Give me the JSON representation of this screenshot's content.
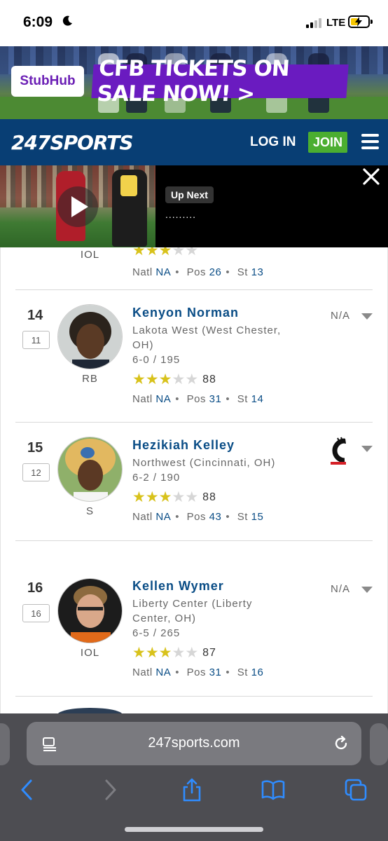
{
  "status_bar": {
    "time": "6:09",
    "network": "LTE"
  },
  "ad": {
    "brand": "StubHub",
    "headline": "CFB TICKETS ON SALE NOW! >"
  },
  "header": {
    "logo": "247SPORTS",
    "login_label": "LOG IN",
    "join_label": "JOIN"
  },
  "video": {
    "up_next_label": "Up Next",
    "up_next_title": "........."
  },
  "partial_row": {
    "rank_line": {
      "natl_label": "Natl",
      "natl": "NA",
      "pos_label": "Pos",
      "pos": "26",
      "st_label": "St",
      "st": "13"
    }
  },
  "players": [
    {
      "rank": "14",
      "prev_rank": "11",
      "name": "Kenyon Norman",
      "school_line1": "Lakota West (West Chester,",
      "school_line2": "OH)",
      "measurables": "6-0 / 195",
      "position": "RB",
      "stars": 3,
      "rating": "88",
      "natl_label": "Natl",
      "natl": "NA",
      "pos_label": "Pos",
      "pos_rank": "31",
      "st_label": "St",
      "st_rank": "14",
      "status": "N/A",
      "team_icon": ""
    },
    {
      "rank": "15",
      "prev_rank": "12",
      "name": "Hezikiah Kelley",
      "school_line1": "Northwest (Cincinnati, OH)",
      "school_line2": "",
      "measurables": "6-2 / 190",
      "position": "S",
      "stars": 3,
      "rating": "88",
      "natl_label": "Natl",
      "natl": "NA",
      "pos_label": "Pos",
      "pos_rank": "43",
      "st_label": "St",
      "st_rank": "15",
      "status": "",
      "team_icon": "cincinnati-c-logo"
    },
    {
      "rank": "16",
      "prev_rank": "16",
      "name": "Kellen Wymer",
      "school_line1": "Liberty Center (Liberty",
      "school_line2": "Center, OH)",
      "measurables": "6-5 / 265",
      "position": "IOL",
      "stars": 3,
      "rating": "87",
      "natl_label": "Natl",
      "natl": "NA",
      "pos_label": "Pos",
      "pos_rank": "31",
      "st_label": "St",
      "st_rank": "16",
      "status": "N/A",
      "team_icon": ""
    }
  ],
  "browser": {
    "url": "247sports.com"
  },
  "colors": {
    "header_bg": "#083e74",
    "join_green": "#4bae30",
    "link_blue": "#0a4d86",
    "star_gold": "#d8c21b",
    "ad_purple": "#6a1bc0"
  }
}
